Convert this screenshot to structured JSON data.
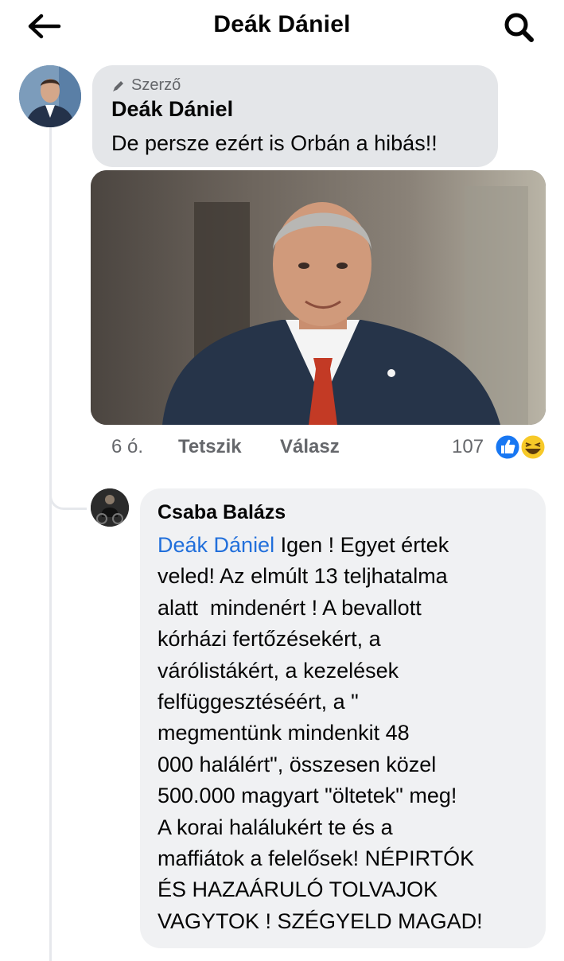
{
  "header": {
    "title": "Deák Dániel",
    "back_icon": "arrow-left-icon",
    "search_icon": "search-icon"
  },
  "comment1": {
    "badge": "Szerző",
    "badge_icon": "pen-icon",
    "author": "Deák Dániel",
    "text": "De persze ezért is Orbán a hibás!!",
    "time": "6 ó.",
    "like_label": "Tetszik",
    "reply_label": "Válasz",
    "reaction_count": "107",
    "reaction_icons": [
      "like-icon",
      "haha-icon"
    ]
  },
  "comment2": {
    "author": "Csaba Balázs",
    "mention": "Deák Dániel",
    "text": " Igen ! Egyet értek\nveled! Az elmúlt 13 teljhatalma\nalatt  mindenért ! A bevallott\nkórházi fertőzésekért, a\nvárólistákért, a kezelések\nfelfüggesztéséért, a \"\nmegmentünk mindenkit 48\n000 halálért\", összesen közel\n500.000 magyart \"öltetek\" meg!\nA korai halálukért te és a\nmaffiátok a felelősek! NÉPIRTÓK\nÉS HAZAÁRULÓ TOLVAJOK\nVAGYTOK ! SZÉGYELD MAGAD!"
  },
  "colors": {
    "bubble1": "#e4e6e9",
    "bubble2": "#f0f1f3",
    "mention": "#216fdb",
    "muted": "#65676b",
    "like_blue": "#1877f2",
    "haha_yellow": "#f7c928"
  }
}
